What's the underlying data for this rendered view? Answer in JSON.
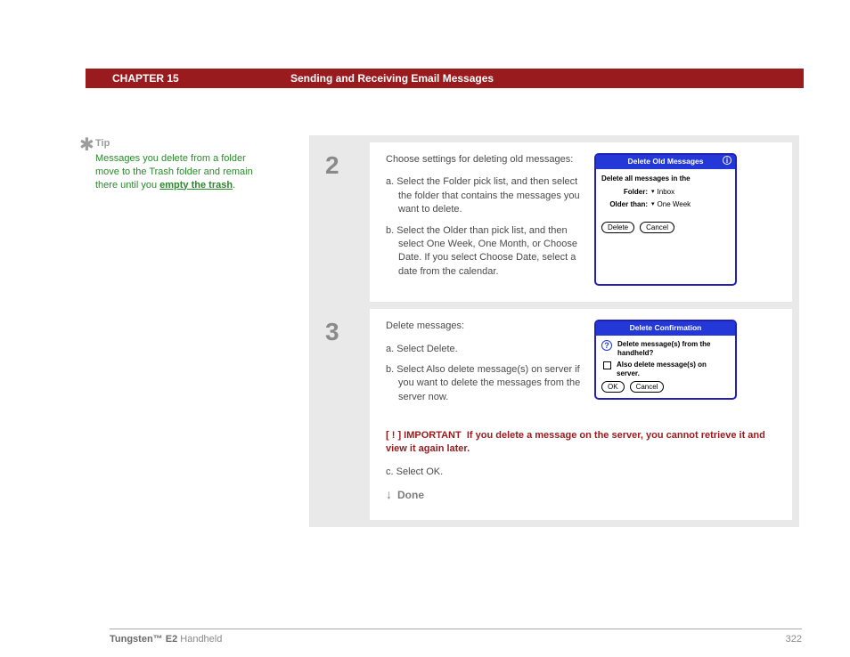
{
  "header": {
    "chapter": "CHAPTER 15",
    "title": "Sending and Receiving Email Messages"
  },
  "tip": {
    "label": "Tip",
    "text_before": "Messages you delete from a folder move to the Trash folder and remain there until you ",
    "link": "empty the trash",
    "text_after": "."
  },
  "step2": {
    "num": "2",
    "intro": "Choose settings for deleting old messages:",
    "a": "a.  Select the Folder pick list, and then select the folder that contains the messages you want to delete.",
    "b": "b.  Select the Older than pick list, and then select One Week, One Month, or Choose Date. If you select Choose Date, select a date from the calendar.",
    "dialog": {
      "title": "Delete Old Messages",
      "line1": "Delete all messages in the",
      "folder_label": "Folder:",
      "folder_value": "Inbox",
      "older_label": "Older than:",
      "older_value": "One Week",
      "btn_delete": "Delete",
      "btn_cancel": "Cancel"
    }
  },
  "step3": {
    "num": "3",
    "intro": "Delete messages:",
    "a": "a.  Select Delete.",
    "b": "b.  Select Also delete message(s) on server if you want to delete the messages from the server now.",
    "important_tag": "[ ! ] IMPORTANT",
    "important_text": "If you delete a message on the server, you cannot retrieve it and view it again later.",
    "c": "c.  Select OK.",
    "done": "Done",
    "dialog": {
      "title": "Delete Confirmation",
      "q": "Delete message(s) from the handheld?",
      "cb": "Also delete message(s) on server.",
      "btn_ok": "OK",
      "btn_cancel": "Cancel"
    }
  },
  "footer": {
    "product_bold": "Tungsten™ E2",
    "product_rest": " Handheld",
    "page": "322"
  }
}
